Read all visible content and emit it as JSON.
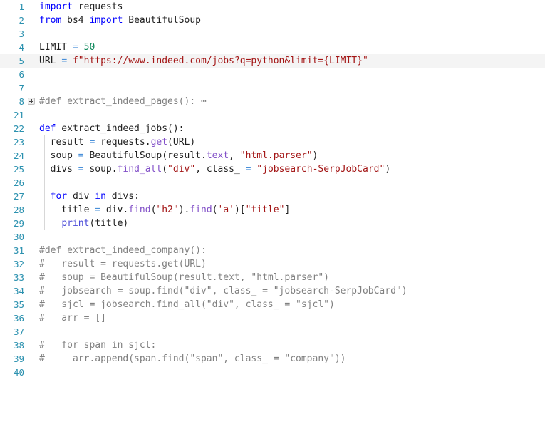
{
  "editor": {
    "language": "python",
    "theme": "light",
    "background_color": "#ffffff",
    "active_line_color": "#f4f4f4",
    "gutter_number_color": "#2b91af",
    "active_line_number": 5,
    "colors": {
      "keyword": "#0000ff",
      "string": "#a31515",
      "number": "#098658",
      "function": "#8250c8",
      "builtin": "#4b4bd8",
      "operator": "#4a90d9",
      "comment": "#808080",
      "identifier": "#1f1f1f",
      "indent_guide": "#d7d7d7"
    }
  },
  "fold_marker": {
    "icon": "plus-square-icon",
    "line": 8,
    "label": "expand-folded-region"
  },
  "lines": [
    {
      "num": "1",
      "active": false,
      "fold": false,
      "guides": 0,
      "tokens": [
        {
          "t": "import",
          "c": "t-kw"
        },
        {
          "t": " requests",
          "c": "t-id"
        }
      ]
    },
    {
      "num": "2",
      "active": false,
      "fold": false,
      "guides": 0,
      "tokens": [
        {
          "t": "from",
          "c": "t-kw"
        },
        {
          "t": " bs4 ",
          "c": "t-id"
        },
        {
          "t": "import",
          "c": "t-kw"
        },
        {
          "t": " BeautifulSoup",
          "c": "t-id"
        }
      ]
    },
    {
      "num": "3",
      "active": false,
      "fold": false,
      "guides": 0,
      "tokens": []
    },
    {
      "num": "4",
      "active": false,
      "fold": false,
      "guides": 0,
      "tokens": [
        {
          "t": "LIMIT ",
          "c": "t-id"
        },
        {
          "t": "=",
          "c": "t-op"
        },
        {
          "t": " ",
          "c": "t-id"
        },
        {
          "t": "50",
          "c": "t-num"
        }
      ]
    },
    {
      "num": "5",
      "active": true,
      "fold": false,
      "guides": 0,
      "tokens": [
        {
          "t": "URL ",
          "c": "t-id"
        },
        {
          "t": "=",
          "c": "t-op"
        },
        {
          "t": " ",
          "c": "t-id"
        },
        {
          "t": "f\"https://www.indeed.com/jobs?q=python&limit={LIMIT}\"",
          "c": "t-str"
        }
      ]
    },
    {
      "num": "6",
      "active": false,
      "fold": false,
      "guides": 0,
      "tokens": []
    },
    {
      "num": "7",
      "active": false,
      "fold": false,
      "guides": 0,
      "tokens": []
    },
    {
      "num": "8",
      "active": false,
      "fold": true,
      "guides": 0,
      "tokens": [
        {
          "t": "#def extract_indeed_pages(): ⋯",
          "c": "t-cmt"
        }
      ]
    },
    {
      "num": "21",
      "active": false,
      "fold": false,
      "guides": 0,
      "tokens": []
    },
    {
      "num": "22",
      "active": false,
      "fold": false,
      "guides": 0,
      "tokens": [
        {
          "t": "def",
          "c": "t-kw"
        },
        {
          "t": " extract_indeed_jobs():",
          "c": "t-id"
        }
      ]
    },
    {
      "num": "23",
      "active": false,
      "fold": false,
      "guides": 1,
      "tokens": [
        {
          "t": "  result ",
          "c": "t-id"
        },
        {
          "t": "=",
          "c": "t-op"
        },
        {
          "t": " requests.",
          "c": "t-id"
        },
        {
          "t": "get",
          "c": "t-fn"
        },
        {
          "t": "(URL)",
          "c": "t-id"
        }
      ]
    },
    {
      "num": "24",
      "active": false,
      "fold": false,
      "guides": 1,
      "tokens": [
        {
          "t": "  soup ",
          "c": "t-id"
        },
        {
          "t": "=",
          "c": "t-op"
        },
        {
          "t": " BeautifulSoup(result.",
          "c": "t-id"
        },
        {
          "t": "text",
          "c": "t-fn"
        },
        {
          "t": ", ",
          "c": "t-id"
        },
        {
          "t": "\"html.parser\"",
          "c": "t-str"
        },
        {
          "t": ")",
          "c": "t-id"
        }
      ]
    },
    {
      "num": "25",
      "active": false,
      "fold": false,
      "guides": 1,
      "tokens": [
        {
          "t": "  divs ",
          "c": "t-id"
        },
        {
          "t": "=",
          "c": "t-op"
        },
        {
          "t": " soup.",
          "c": "t-id"
        },
        {
          "t": "find_all",
          "c": "t-fn"
        },
        {
          "t": "(",
          "c": "t-id"
        },
        {
          "t": "\"div\"",
          "c": "t-str"
        },
        {
          "t": ", class_ ",
          "c": "t-id"
        },
        {
          "t": "=",
          "c": "t-op"
        },
        {
          "t": " ",
          "c": "t-id"
        },
        {
          "t": "\"jobsearch-SerpJobCard\"",
          "c": "t-str"
        },
        {
          "t": ")",
          "c": "t-id"
        }
      ]
    },
    {
      "num": "26",
      "active": false,
      "fold": false,
      "guides": 1,
      "tokens": []
    },
    {
      "num": "27",
      "active": false,
      "fold": false,
      "guides": 1,
      "tokens": [
        {
          "t": "  ",
          "c": "t-id"
        },
        {
          "t": "for",
          "c": "t-kw"
        },
        {
          "t": " div ",
          "c": "t-id"
        },
        {
          "t": "in",
          "c": "t-kw"
        },
        {
          "t": " divs:",
          "c": "t-id"
        }
      ]
    },
    {
      "num": "28",
      "active": false,
      "fold": false,
      "guides": 2,
      "tokens": [
        {
          "t": "    title ",
          "c": "t-id"
        },
        {
          "t": "=",
          "c": "t-op"
        },
        {
          "t": " div.",
          "c": "t-id"
        },
        {
          "t": "find",
          "c": "t-fn"
        },
        {
          "t": "(",
          "c": "t-id"
        },
        {
          "t": "\"h2\"",
          "c": "t-str"
        },
        {
          "t": ").",
          "c": "t-id"
        },
        {
          "t": "find",
          "c": "t-fn"
        },
        {
          "t": "(",
          "c": "t-id"
        },
        {
          "t": "'a'",
          "c": "t-str"
        },
        {
          "t": ")[",
          "c": "t-id"
        },
        {
          "t": "\"title\"",
          "c": "t-str"
        },
        {
          "t": "]",
          "c": "t-id"
        }
      ]
    },
    {
      "num": "29",
      "active": false,
      "fold": false,
      "guides": 2,
      "tokens": [
        {
          "t": "    ",
          "c": "t-id"
        },
        {
          "t": "print",
          "c": "t-builtin"
        },
        {
          "t": "(title)",
          "c": "t-id"
        }
      ]
    },
    {
      "num": "30",
      "active": false,
      "fold": false,
      "guides": 0,
      "tokens": []
    },
    {
      "num": "31",
      "active": false,
      "fold": false,
      "guides": 0,
      "tokens": [
        {
          "t": "#def extract_indeed_company():",
          "c": "t-cmt"
        }
      ]
    },
    {
      "num": "32",
      "active": false,
      "fold": false,
      "guides": 0,
      "tokens": [
        {
          "t": "#   result = requests.get(URL)",
          "c": "t-cmt"
        }
      ]
    },
    {
      "num": "33",
      "active": false,
      "fold": false,
      "guides": 0,
      "tokens": [
        {
          "t": "#   soup = BeautifulSoup(result.text, \"html.parser\")",
          "c": "t-cmt"
        }
      ]
    },
    {
      "num": "34",
      "active": false,
      "fold": false,
      "guides": 0,
      "tokens": [
        {
          "t": "#   jobsearch = soup.find(\"div\", class_ = \"jobsearch-SerpJobCard\")",
          "c": "t-cmt"
        }
      ]
    },
    {
      "num": "35",
      "active": false,
      "fold": false,
      "guides": 0,
      "tokens": [
        {
          "t": "#   sjcl = jobsearch.find_all(\"div\", class_ = \"sjcl\")",
          "c": "t-cmt"
        }
      ]
    },
    {
      "num": "36",
      "active": false,
      "fold": false,
      "guides": 0,
      "tokens": [
        {
          "t": "#   arr = []",
          "c": "t-cmt"
        }
      ]
    },
    {
      "num": "37",
      "active": false,
      "fold": false,
      "guides": 0,
      "tokens": []
    },
    {
      "num": "38",
      "active": false,
      "fold": false,
      "guides": 0,
      "tokens": [
        {
          "t": "#   for span in sjcl:",
          "c": "t-cmt"
        }
      ]
    },
    {
      "num": "39",
      "active": false,
      "fold": false,
      "guides": 0,
      "tokens": [
        {
          "t": "#     arr.append(span.find(\"span\", class_ = \"company\"))",
          "c": "t-cmt"
        }
      ]
    },
    {
      "num": "40",
      "active": false,
      "fold": false,
      "guides": 0,
      "tokens": []
    }
  ]
}
